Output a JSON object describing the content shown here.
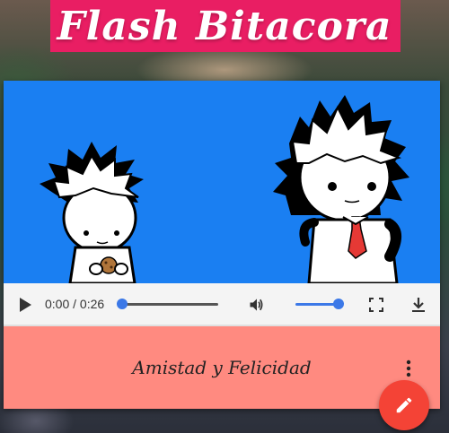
{
  "header": {
    "title": "Flash Bitacora"
  },
  "video": {
    "current_time": "0:00",
    "duration": "0:26",
    "time_display": "0:00 / 0:26",
    "progress": 0.0,
    "volume": 1.0,
    "background_color": "#1a7ff2"
  },
  "controls": {
    "play_icon": "play-icon",
    "volume_icon": "volume-icon",
    "fullscreen_icon": "fullscreen-icon",
    "download_icon": "download-icon"
  },
  "card": {
    "title": "Amistad y Felicidad",
    "background_color": "#ff8a80",
    "menu_icon": "more-vert-icon"
  },
  "fab": {
    "icon": "pencil-icon",
    "color": "#f44336"
  },
  "colors": {
    "header": "#e91e63",
    "accent": "#3b78e7"
  }
}
